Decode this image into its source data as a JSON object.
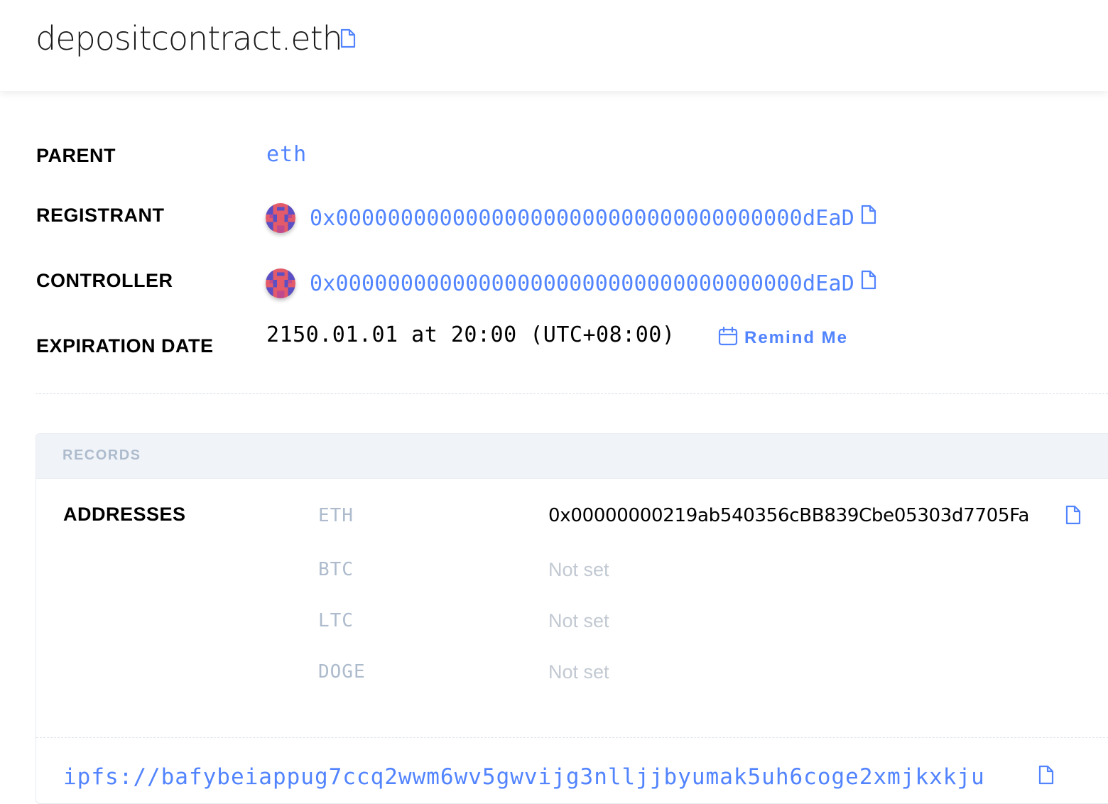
{
  "header": {
    "domain_name": "depositcontract.eth"
  },
  "details": {
    "parent_label": "PARENT",
    "parent_value": "eth",
    "registrant_label": "REGISTRANT",
    "registrant_address": "0x000000000000000000000000000000000000dEaD",
    "controller_label": "CONTROLLER",
    "controller_address": "0x000000000000000000000000000000000000dEaD",
    "expiration_label": "EXPIRATION DATE",
    "expiration_value": "2150.01.01 at 20:00 (UTC+08:00)",
    "remind_label": "Remind Me"
  },
  "records": {
    "title": "RECORDS",
    "addresses_label": "ADDRESSES",
    "coins": [
      {
        "symbol": "ETH",
        "value": "0x00000000219ab540356cBB839Cbe05303d7705Fa"
      },
      {
        "symbol": "BTC",
        "value": "Not set"
      },
      {
        "symbol": "LTC",
        "value": "Not set"
      },
      {
        "symbol": "DOGE",
        "value": "Not set"
      }
    ],
    "content_hash": "ipfs://bafybeiappug7ccq2wwm6wv5gwvijg3nlljjbyumak5uh6coge2xmjkxkju"
  },
  "colors": {
    "accent": "#5284ff",
    "muted": "#adbbcd",
    "records_header_bg": "#f0f4f8"
  },
  "icons": {
    "copy": "copy-icon",
    "calendar": "calendar-icon",
    "avatar": "blockie-avatar"
  }
}
